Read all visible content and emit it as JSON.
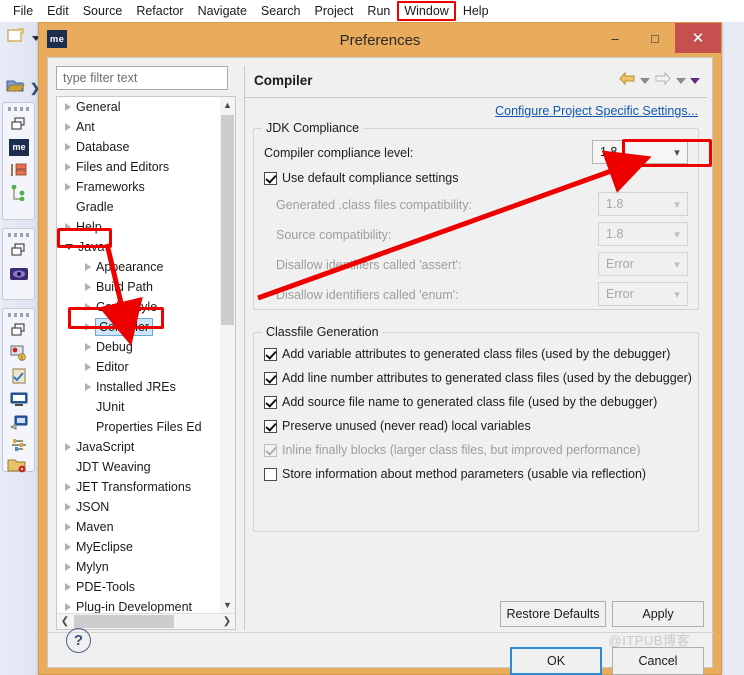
{
  "menubar": {
    "items": [
      {
        "label": "File",
        "highlighted": false
      },
      {
        "label": "Edit",
        "highlighted": false
      },
      {
        "label": "Source",
        "highlighted": false
      },
      {
        "label": "Refactor",
        "highlighted": false
      },
      {
        "label": "Navigate",
        "highlighted": false
      },
      {
        "label": "Search",
        "highlighted": false
      },
      {
        "label": "Project",
        "highlighted": false
      },
      {
        "label": "Run",
        "highlighted": false
      },
      {
        "label": "Window",
        "highlighted": true
      },
      {
        "label": "Help",
        "highlighted": false
      }
    ]
  },
  "window": {
    "logo_text": "me",
    "title": "Preferences",
    "minimize_glyph": "–",
    "maximize_glyph": "□",
    "close_glyph": "✕"
  },
  "filter": {
    "placeholder": "type filter text",
    "value": ""
  },
  "tree": {
    "items": [
      {
        "label": "General",
        "indent": 0,
        "arrow": "right",
        "selected": false
      },
      {
        "label": "Ant",
        "indent": 0,
        "arrow": "right",
        "selected": false
      },
      {
        "label": "Database",
        "indent": 0,
        "arrow": "right",
        "selected": false
      },
      {
        "label": "Files and Editors",
        "indent": 0,
        "arrow": "right",
        "selected": false
      },
      {
        "label": "Frameworks",
        "indent": 0,
        "arrow": "right",
        "selected": false
      },
      {
        "label": "Gradle",
        "indent": 0,
        "arrow": "none",
        "selected": false
      },
      {
        "label": "Help",
        "indent": 0,
        "arrow": "right",
        "selected": false
      },
      {
        "label": "Java",
        "indent": 0,
        "arrow": "down",
        "selected": false
      },
      {
        "label": "Appearance",
        "indent": 1,
        "arrow": "right",
        "selected": false
      },
      {
        "label": "Build Path",
        "indent": 1,
        "arrow": "right",
        "selected": false
      },
      {
        "label": "Code Style",
        "indent": 1,
        "arrow": "right",
        "selected": false
      },
      {
        "label": "Compiler",
        "indent": 1,
        "arrow": "right",
        "selected": true
      },
      {
        "label": "Debug",
        "indent": 1,
        "arrow": "right",
        "selected": false
      },
      {
        "label": "Editor",
        "indent": 1,
        "arrow": "right",
        "selected": false
      },
      {
        "label": "Installed JREs",
        "indent": 1,
        "arrow": "right",
        "selected": false
      },
      {
        "label": "JUnit",
        "indent": 1,
        "arrow": "none",
        "selected": false
      },
      {
        "label": "Properties Files Ed",
        "indent": 1,
        "arrow": "none",
        "selected": false
      },
      {
        "label": "JavaScript",
        "indent": 0,
        "arrow": "right",
        "selected": false
      },
      {
        "label": "JDT Weaving",
        "indent": 0,
        "arrow": "none",
        "selected": false
      },
      {
        "label": "JET Transformations",
        "indent": 0,
        "arrow": "right",
        "selected": false
      },
      {
        "label": "JSON",
        "indent": 0,
        "arrow": "right",
        "selected": false
      },
      {
        "label": "Maven",
        "indent": 0,
        "arrow": "right",
        "selected": false
      },
      {
        "label": "MyEclipse",
        "indent": 0,
        "arrow": "right",
        "selected": false
      },
      {
        "label": "Mylyn",
        "indent": 0,
        "arrow": "right",
        "selected": false
      },
      {
        "label": "PDE-Tools",
        "indent": 0,
        "arrow": "right",
        "selected": false
      },
      {
        "label": "Plug-in Development",
        "indent": 0,
        "arrow": "right",
        "selected": false
      }
    ],
    "scroll_up_glyph": "▲",
    "scroll_down_glyph": "▼",
    "scroll_left_glyph": "❮",
    "scroll_right_glyph": "❯"
  },
  "content": {
    "title": "Compiler",
    "project_link": "Configure Project Specific Settings...",
    "jdk_group_title": "JDK Compliance",
    "compliance_label": "Compiler compliance level:",
    "compliance_value": "1.8",
    "use_default_label": "Use default compliance settings",
    "use_default_checked": true,
    "dim_rows": [
      {
        "label": "Generated .class files compatibility:",
        "value": "1.8"
      },
      {
        "label": "Source compatibility:",
        "value": "1.8"
      },
      {
        "label": "Disallow identifiers called 'assert':",
        "value": "Error"
      },
      {
        "label": "Disallow identifiers called 'enum':",
        "value": "Error"
      }
    ],
    "classfile_group_title": "Classfile Generation",
    "classfile_options": [
      {
        "label": "Add variable attributes to generated class files (used by the debugger)",
        "checked": true,
        "enabled": true
      },
      {
        "label": "Add line number attributes to generated class files (used by the debugger)",
        "checked": true,
        "enabled": true
      },
      {
        "label": "Add source file name to generated class file (used by the debugger)",
        "checked": true,
        "enabled": true
      },
      {
        "label": "Preserve unused (never read) local variables",
        "checked": true,
        "enabled": true
      },
      {
        "label": "Inline finally blocks (larger class files, but improved performance)",
        "checked": true,
        "enabled": false
      },
      {
        "label": "Store information about method parameters (usable via reflection)",
        "checked": false,
        "enabled": true
      }
    ]
  },
  "buttons": {
    "restore_defaults": "Restore Defaults",
    "apply": "Apply",
    "ok": "OK",
    "cancel": "Cancel",
    "help_glyph": "?"
  },
  "nav": {
    "back_glyph": "⇦",
    "forward_glyph": "⇨"
  },
  "watermark": "@ITPUB博客",
  "colors": {
    "title_bar": "#e8ac5c",
    "close_button": "#c6504f",
    "annotation_red": "#ee0000",
    "link_blue": "#1158b0",
    "selection_blue": "#cde6f7",
    "primary_button_border": "#2d8ad6"
  }
}
